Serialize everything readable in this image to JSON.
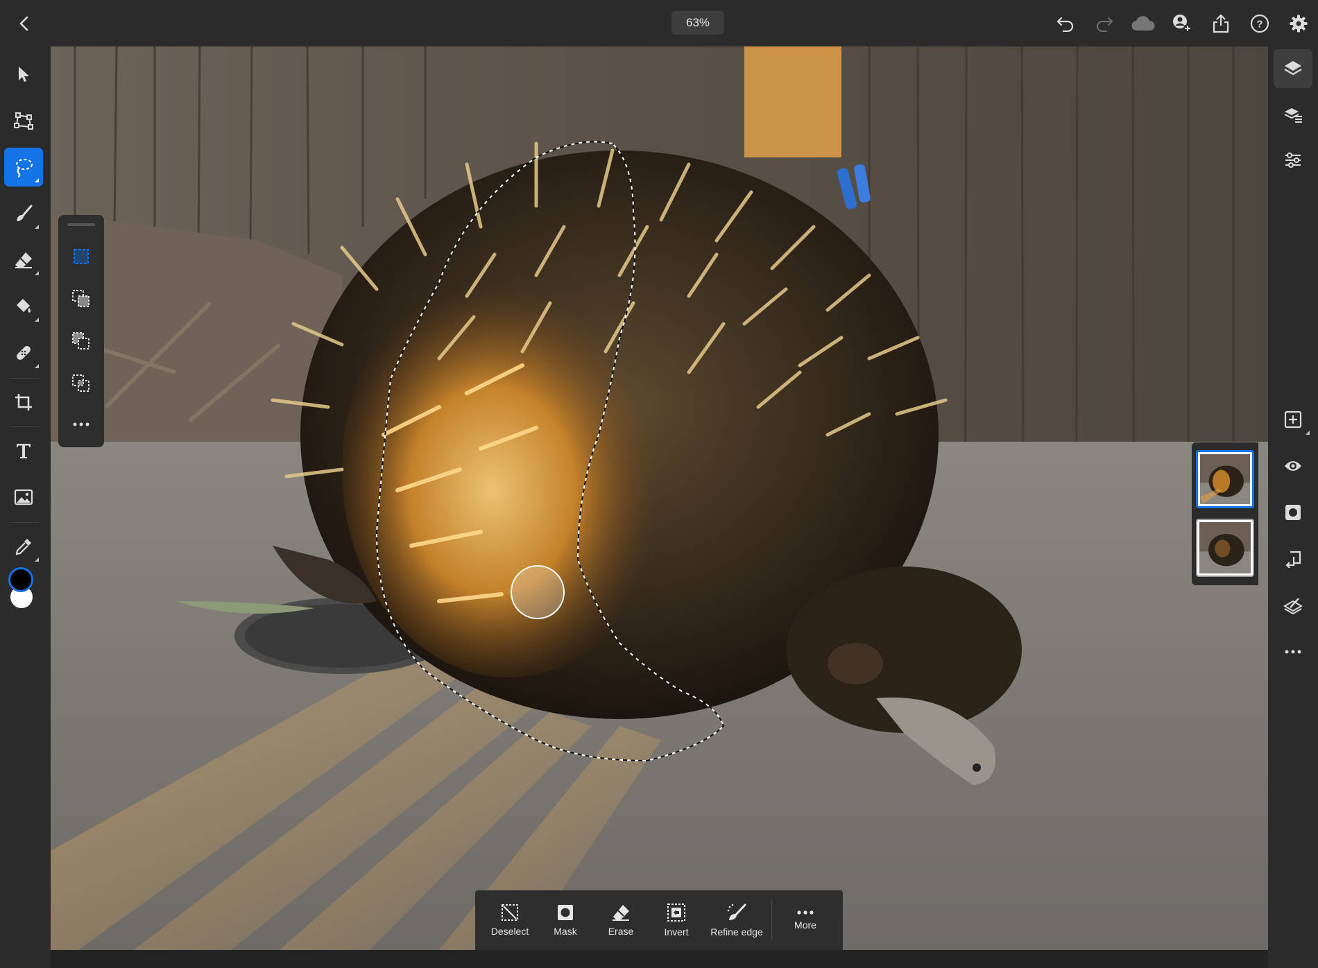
{
  "topbar": {
    "zoom_label": "63%",
    "icons": [
      {
        "name": "undo-icon"
      },
      {
        "name": "redo-icon",
        "disabled": true
      },
      {
        "name": "cloud-icon"
      },
      {
        "name": "invite-user-icon"
      },
      {
        "name": "share-icon"
      },
      {
        "name": "help-icon"
      },
      {
        "name": "settings-gear-icon"
      }
    ]
  },
  "left_toolbar": {
    "tools": [
      {
        "name": "move-tool-icon"
      },
      {
        "name": "transform-tool-icon"
      },
      {
        "name": "lasso-select-tool-icon",
        "active": true
      },
      {
        "name": "brush-tool-icon"
      },
      {
        "name": "eraser-tool-icon"
      },
      {
        "name": "fill-tool-icon"
      },
      {
        "name": "healing-tool-icon"
      },
      {
        "name": "crop-tool-icon"
      },
      {
        "name": "type-tool-icon"
      },
      {
        "name": "place-image-tool-icon"
      },
      {
        "name": "eyedropper-tool-icon"
      }
    ],
    "foreground_color": "#000000",
    "background_color": "#ffffff",
    "accent_color": "#1473e6"
  },
  "selection_modes": [
    {
      "name": "new-selection-icon",
      "active": true
    },
    {
      "name": "add-to-selection-icon"
    },
    {
      "name": "subtract-from-selection-icon"
    },
    {
      "name": "intersect-selection-icon"
    },
    {
      "name": "more-options-icon"
    }
  ],
  "right_toolbar": {
    "tools": [
      {
        "name": "layers-icon",
        "active": true
      },
      {
        "name": "layer-properties-icon"
      },
      {
        "name": "adjustments-icon"
      },
      {
        "name": "add-layer-icon"
      },
      {
        "name": "visibility-eye-icon"
      },
      {
        "name": "layer-mask-icon"
      },
      {
        "name": "merge-down-icon"
      },
      {
        "name": "clipping-mask-icon"
      },
      {
        "name": "more-icon"
      }
    ]
  },
  "layers": [
    {
      "name": "layer-thumbnail-top",
      "selected": true
    },
    {
      "name": "layer-thumbnail-bottom",
      "selected": false
    }
  ],
  "action_bar": {
    "deselect_label": "Deselect",
    "mask_label": "Mask",
    "erase_label": "Erase",
    "invert_label": "Invert",
    "refine_edge_label": "Refine edge",
    "more_label": "More"
  }
}
